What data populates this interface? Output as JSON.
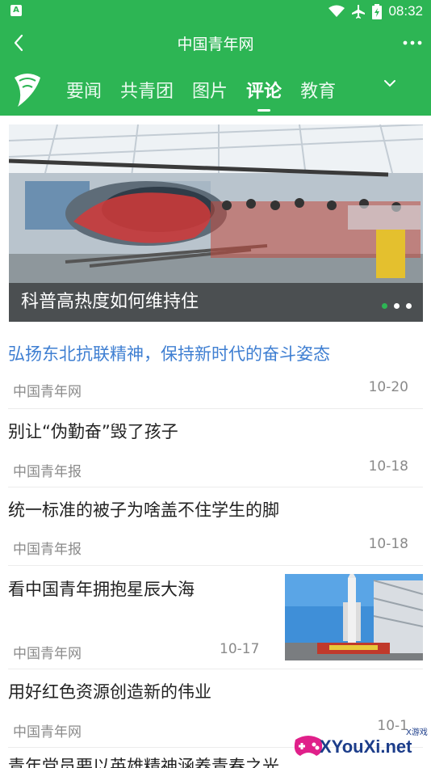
{
  "status_bar": {
    "time": "08:32",
    "app_icon_letter": "A"
  },
  "header": {
    "title": "中国青年网"
  },
  "channels": {
    "tabs": [
      {
        "label": "要闻",
        "active": false
      },
      {
        "label": "共青团",
        "active": false
      },
      {
        "label": "图片",
        "active": false
      },
      {
        "label": "评论",
        "active": true
      },
      {
        "label": "教育",
        "active": false
      }
    ]
  },
  "banner": {
    "caption": "科普高热度如何维持住",
    "dots": 3,
    "active_dot": 0
  },
  "news": [
    {
      "headline": "弘扬东北抗联精神，保持新时代的奋斗姿态",
      "source": "中国青年网",
      "date": "10-20",
      "highlight": true
    },
    {
      "headline": "别让“伪勤奋”毁了孩子",
      "source": "中国青年报",
      "date": "10-18"
    },
    {
      "headline": "统一标准的被子为啥盖不住学生的脚",
      "source": "中国青年报",
      "date": "10-18"
    },
    {
      "headline": "看中国青年拥抱星辰大海",
      "source": "中国青年网",
      "date": "10-17",
      "has_thumb": true
    },
    {
      "headline": "用好红色资源创造新的伟业",
      "source": "中国青年网",
      "date": "10-1"
    },
    {
      "headline": "青年党员要以英雄精神涵养青春之光"
    }
  ],
  "watermark": {
    "text": "XYouXi.net",
    "small": "X游戏"
  },
  "colors": {
    "brand_green": "#2db554",
    "link_blue": "#3f7fd2"
  },
  "icons": [
    "back-arrow-icon",
    "more-dots-icon",
    "logo-icon",
    "chevron-down-icon",
    "wifi-icon",
    "airplane-icon",
    "battery-icon"
  ]
}
